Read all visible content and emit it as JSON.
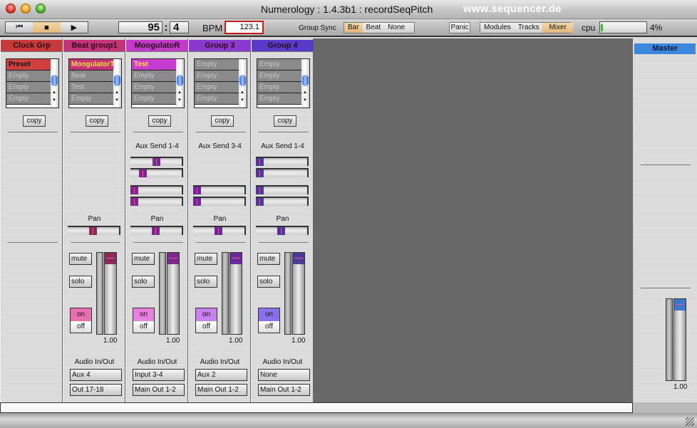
{
  "window": {
    "title": "Numerology : 1.4.3b1 : recordSeqPitch",
    "watermark": "www.sequencer.de"
  },
  "toolbar": {
    "transport": {
      "rewind_icon": "rewind-to-start-icon",
      "stop_icon": "stop-icon",
      "play_icon": "play-icon",
      "rewind_glyph": "⏮",
      "stop_glyph": "■",
      "play_glyph": "▶"
    },
    "position": {
      "bar": "95",
      "separator": ":",
      "beat": "4"
    },
    "bpm_label": "BPM",
    "bpm_value": "123.1",
    "group_sync": {
      "label": "Group Sync",
      "options": [
        "Bar",
        "Beat",
        "None"
      ],
      "selected": "Bar"
    },
    "panic_label": "Panic",
    "views": {
      "options": [
        "Modules",
        "Tracks",
        "Mixer"
      ],
      "selected": "Mixer"
    },
    "cpu": {
      "label": "cpu",
      "percent": 4,
      "value_text": "4%",
      "color": "#1ecb1e"
    }
  },
  "strips": [
    {
      "name": "Clock Grp",
      "color": "#c83a3a",
      "knob_color": "#8a2a5a",
      "presets": [
        "Preset",
        "Empty",
        "Empty",
        "Empty"
      ],
      "first_highlight": "#d04040",
      "first_text": "#111111",
      "copy_label": "copy",
      "has_aux": false,
      "has_pan": false,
      "has_channel": false
    },
    {
      "name": "Beat group1",
      "color": "#c4327a",
      "knob_color": "#8a2a5a",
      "presets": [
        "MoogulatorT",
        "Beat",
        "Test",
        "Empty"
      ],
      "first_highlight": "#c4327a",
      "first_text": "#ffe030",
      "copy_label": "copy",
      "has_aux": false,
      "has_pan": true,
      "pan_label": "Pan",
      "pan": 0.5,
      "has_channel": true,
      "mute_label": "mute",
      "solo_label": "solo",
      "on_label": "on",
      "off_label": "off",
      "on_color": "#e870b0",
      "fader_value": "1.00",
      "fader_level": 1.0,
      "io_label": "Audio In/Out",
      "input": "Aux 4",
      "output": "Out 17-18"
    },
    {
      "name": "MoogulatoR",
      "color": "#c23ac8",
      "knob_color": "#7a2a8a",
      "presets": [
        "Test",
        "Empty",
        "Empty",
        "Empty"
      ],
      "first_highlight": "#c83ad0",
      "first_text": "#ffe030",
      "copy_label": "copy",
      "has_aux": true,
      "aux_label": "Aux Send 1-4",
      "aux": [
        0.5,
        0.2,
        0.0,
        0.0
      ],
      "aux_rows": [
        true,
        true,
        true,
        true
      ],
      "has_pan": true,
      "pan_label": "Pan",
      "pan": 0.5,
      "has_channel": true,
      "mute_label": "mute",
      "solo_label": "solo",
      "on_label": "on",
      "off_label": "off",
      "on_color": "#e880e0",
      "fader_value": "1.00",
      "fader_level": 1.0,
      "io_label": "Audio In/Out",
      "input": "Input 3-4",
      "output": "Main Out 1-2"
    },
    {
      "name": "Group 3",
      "color": "#8a3ad0",
      "knob_color": "#6a2a9a",
      "presets": [
        "Empty",
        "Empty",
        "Empty",
        "Empty"
      ],
      "first_highlight": "#8a8a8a",
      "first_text": "#c8c8c8",
      "copy_label": "copy",
      "has_aux": true,
      "aux_label": "Aux Send 3-4",
      "aux": [
        0.0,
        0.0
      ],
      "aux_rows": [
        false,
        false,
        true,
        true
      ],
      "has_pan": true,
      "pan_label": "Pan",
      "pan": 0.5,
      "has_channel": true,
      "mute_label": "mute",
      "solo_label": "solo",
      "on_label": "on",
      "off_label": "off",
      "on_color": "#c880f0",
      "fader_value": "1.00",
      "fader_level": 1.0,
      "io_label": "Audio In/Out",
      "input": "Aux 2",
      "output": "Main Out 1-2"
    },
    {
      "name": "Group 4",
      "color": "#5a3ac8",
      "knob_color": "#4a3a9a",
      "presets": [
        "Empty",
        "Empty",
        "Empty",
        "Empty"
      ],
      "first_highlight": "#8a8a8a",
      "first_text": "#c8c8c8",
      "copy_label": "copy",
      "has_aux": true,
      "aux_label": "Aux Send 1-4",
      "aux": [
        0.0,
        0.0,
        0.0,
        0.0
      ],
      "aux_rows": [
        true,
        true,
        true,
        true
      ],
      "has_pan": true,
      "pan_label": "Pan",
      "pan": 0.5,
      "has_channel": true,
      "mute_label": "mute",
      "solo_label": "solo",
      "on_label": "on",
      "off_label": "off",
      "on_color": "#8a70f0",
      "fader_value": "1.00",
      "fader_level": 1.0,
      "io_label": "Audio In/Out",
      "input": "None",
      "output": "Main Out 1-2"
    }
  ],
  "master": {
    "name": "Master",
    "color": "#3b86df",
    "fader_value": "1.00",
    "fader_level": 1.0
  }
}
